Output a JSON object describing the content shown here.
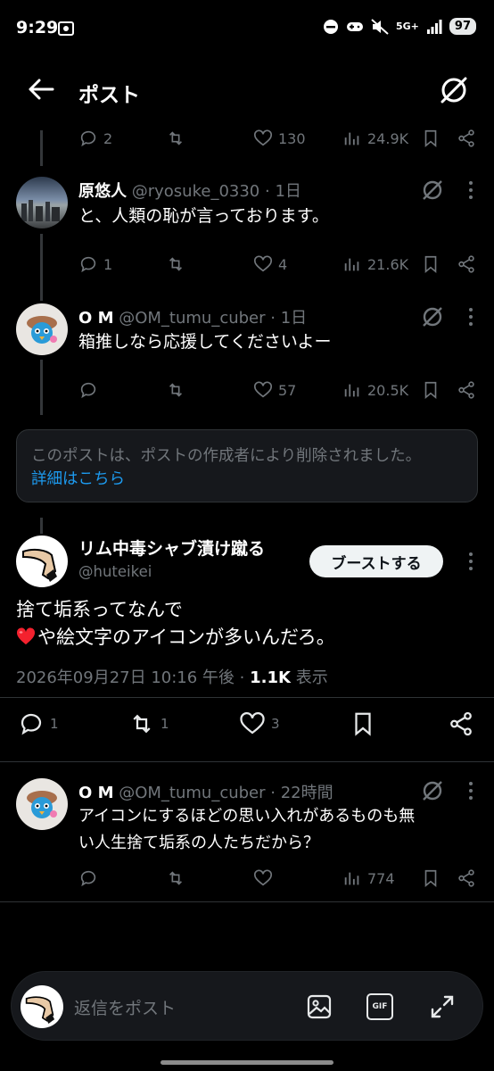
{
  "status": {
    "time": "9:29",
    "network": "5G+",
    "battery": "97"
  },
  "header": {
    "title": "ポスト"
  },
  "thread": {
    "top_actions": {
      "replies": "2",
      "likes": "130",
      "views": "24.9K"
    },
    "tweets": [
      {
        "name": "原悠人",
        "handle": "@ryosuke_0330",
        "time": "1日",
        "text": "と、人類の恥が言っております。",
        "replies": "1",
        "retweets": "",
        "likes": "4",
        "views": "21.6K"
      },
      {
        "name": "O M",
        "handle": "@OM_tumu_cuber",
        "time": "1日",
        "text": "箱推しなら応援してくださいよー",
        "replies": "",
        "retweets": "",
        "likes": "57",
        "views": "20.5K"
      }
    ]
  },
  "deleted_notice": {
    "text": "このポストは、ポストの作成者により削除されました。",
    "link": "詳細はこちら"
  },
  "main_post": {
    "name": "リム中毒シャブ漬け蹴る",
    "handle": "@huteikei",
    "boost_label": "ブーストする",
    "text_line1": "捨て垢系ってなんで",
    "text_line2": "や絵文字のアイコンが多いんだろ。",
    "date": "2026年09月27日 10:16 午後",
    "views": "1.1K",
    "views_label": "表示",
    "replies": "1",
    "retweets": "1",
    "likes": "3"
  },
  "reply_tweet": {
    "name": "O M",
    "handle": "@OM_tumu_cuber",
    "time": "22時間",
    "text_line1": "アイコンにするほどの思い入れがあるものも無",
    "text_line2": "い人生捨て垢系の人たちだから？",
    "views": "774"
  },
  "reply_bar": {
    "placeholder": "返信をポスト",
    "gif_label": "GIF"
  },
  "colors": {
    "background": "#000000",
    "accent": "#1d9bf0",
    "muted": "#71767b",
    "heart": "#f4212e"
  }
}
